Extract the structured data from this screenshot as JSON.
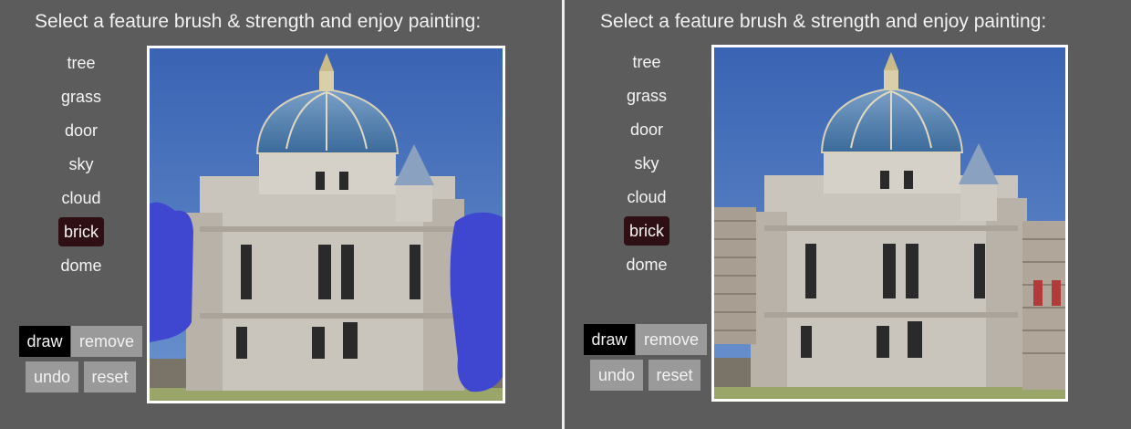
{
  "left_panel": {
    "title": "Select a feature brush & strength and enjoy painting:",
    "brushes": [
      "tree",
      "grass",
      "door",
      "sky",
      "cloud",
      "brick",
      "dome"
    ],
    "active_brush": "brick",
    "buttons": {
      "draw": "draw",
      "remove": "remove",
      "undo": "undo",
      "reset": "reset"
    }
  },
  "right_panel": {
    "title": "Select a feature brush & strength and enjoy painting:",
    "brushes": [
      "tree",
      "grass",
      "door",
      "sky",
      "cloud",
      "brick",
      "dome"
    ],
    "active_brush": "brick",
    "buttons": {
      "draw": "draw",
      "remove": "remove",
      "undo": "undo",
      "reset": "reset"
    }
  },
  "colors": {
    "background": "#5c5c5c",
    "active_brush_bg": "#2e0f14",
    "paint_stroke": "#3f47d1",
    "sky": "#3e6cba"
  },
  "mode": "draw"
}
